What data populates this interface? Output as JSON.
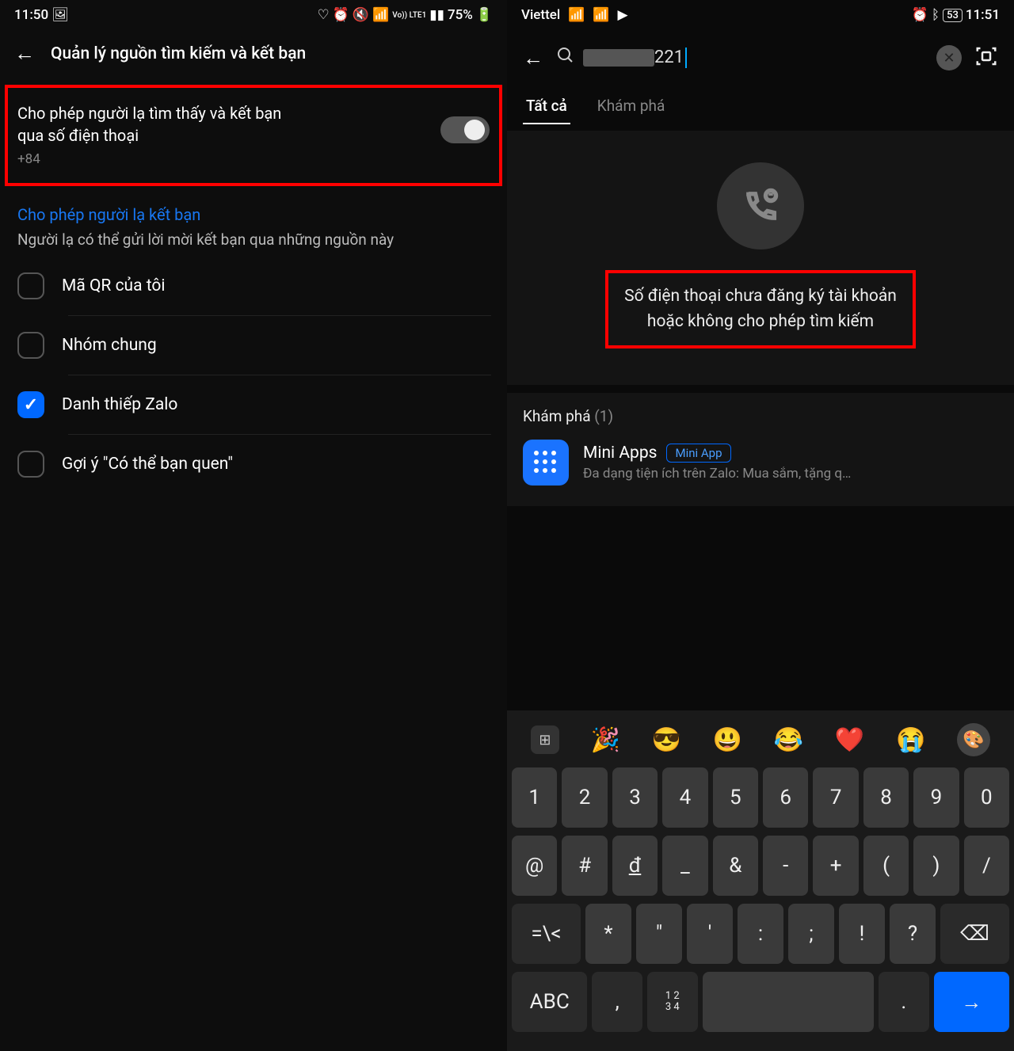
{
  "left": {
    "status": {
      "time": "11:50",
      "battery": "75%"
    },
    "headerTitle": "Quản lý nguồn tìm kiếm và kết bạn",
    "toggle": {
      "line1": "Cho phép người lạ tìm thấy và kết bạn",
      "line2": "qua số điện thoại",
      "phone": "+84",
      "enabled": false
    },
    "sectionTitle": "Cho phép người lạ kết bạn",
    "sectionDesc": "Người lạ có thể gửi lời mời kết bạn qua những nguồn này",
    "options": [
      {
        "label": "Mã QR của tôi",
        "checked": false
      },
      {
        "label": "Nhóm chung",
        "checked": false
      },
      {
        "label": "Danh thiếp Zalo",
        "checked": true
      },
      {
        "label": "Gợi ý \"Có thể bạn quen\"",
        "checked": false
      }
    ]
  },
  "right": {
    "status": {
      "carrier": "Viettel",
      "battery": "53",
      "time": "11:51"
    },
    "search": {
      "value": "221"
    },
    "tabs": [
      {
        "label": "Tất cả",
        "active": true
      },
      {
        "label": "Khám phá",
        "active": false
      }
    ],
    "message": {
      "l1": "Số điện thoại chưa đăng ký tài khoản",
      "l2": "hoặc không cho phép tìm kiếm"
    },
    "discover": {
      "title": "Khám phá",
      "count": "(1)",
      "item": {
        "name": "Mini Apps",
        "badge": "Mini App",
        "sub": "Đa dạng tiện ích trên Zalo: Mua sắm, tặng q…"
      }
    },
    "keyboard": {
      "emojis": [
        "🎉",
        "😎",
        "😃",
        "😂",
        "❤️",
        "😭"
      ],
      "row1": [
        "1",
        "2",
        "3",
        "4",
        "5",
        "6",
        "7",
        "8",
        "9",
        "0"
      ],
      "row2": [
        "@",
        "#",
        "đ",
        "_",
        "&",
        "-",
        "+",
        "(",
        ")",
        "/"
      ],
      "row3": [
        "=\\<",
        "*",
        "\"",
        "'",
        ":",
        ";",
        "!",
        "?",
        "⌫"
      ],
      "row4": {
        "abc": "ABC",
        "num": "1 2\n3 4",
        "comma": ",",
        "dot": "."
      }
    }
  }
}
